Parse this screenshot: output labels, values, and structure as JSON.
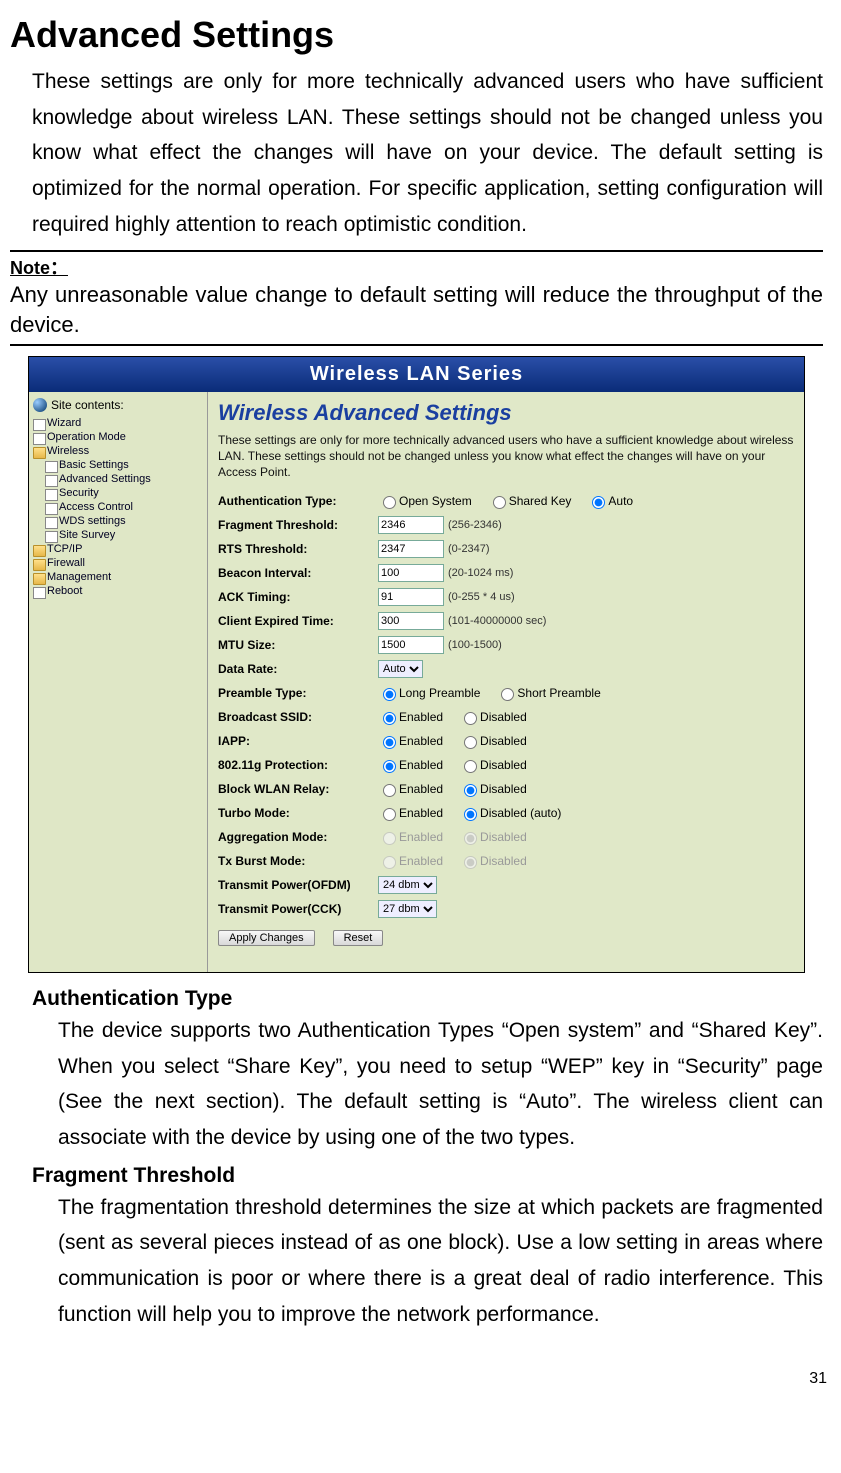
{
  "title": "Advanced Settings",
  "intro": "These settings are only for more technically advanced users who have sufficient knowledge about wireless LAN. These settings should not be changed unless you know what effect the changes will have on your device. The default setting is optimized for the normal operation. For specific application, setting configuration will required highly attention to reach optimistic condition.",
  "note_label": "Note：",
  "note_text": "Any unreasonable value change to default setting will reduce the throughput of the device.",
  "shot": {
    "banner": "Wireless LAN Series",
    "side_title": "Site contents:",
    "tree": {
      "items": [
        {
          "label": "Wizard",
          "cls": ""
        },
        {
          "label": "Operation Mode",
          "cls": ""
        },
        {
          "label": "Wireless",
          "cls": "folder",
          "children": [
            {
              "label": "Basic Settings"
            },
            {
              "label": "Advanced Settings"
            },
            {
              "label": "Security"
            },
            {
              "label": "Access Control"
            },
            {
              "label": "WDS settings"
            },
            {
              "label": "Site Survey"
            }
          ]
        },
        {
          "label": "TCP/IP",
          "cls": "folder"
        },
        {
          "label": "Firewall",
          "cls": "folder"
        },
        {
          "label": "Management",
          "cls": "folder"
        },
        {
          "label": "Reboot",
          "cls": ""
        }
      ]
    },
    "main_title": "Wireless Advanced Settings",
    "main_desc": "These settings are only for more technically advanced users who have a sufficient knowledge about wireless LAN. These settings should not be changed unless you know what effect the changes will have on your Access Point.",
    "fields": {
      "auth": {
        "label": "Authentication Type:",
        "opts": [
          "Open System",
          "Shared Key",
          "Auto"
        ],
        "sel": 2
      },
      "frag": {
        "label": "Fragment Threshold:",
        "value": "2346",
        "hint": "(256-2346)"
      },
      "rts": {
        "label": "RTS Threshold:",
        "value": "2347",
        "hint": "(0-2347)"
      },
      "beacon": {
        "label": "Beacon Interval:",
        "value": "100",
        "hint": "(20-1024 ms)"
      },
      "ack": {
        "label": "ACK Timing:",
        "value": "91",
        "hint": "(0-255 * 4 us)"
      },
      "exp": {
        "label": "Client Expired Time:",
        "value": "300",
        "hint": "(101-40000000 sec)"
      },
      "mtu": {
        "label": "MTU Size:",
        "value": "1500",
        "hint": "(100-1500)"
      },
      "rate": {
        "label": "Data Rate:",
        "value": "Auto"
      },
      "pre": {
        "label": "Preamble Type:",
        "opts": [
          "Long Preamble",
          "Short Preamble"
        ],
        "sel": 0
      },
      "bssid": {
        "label": "Broadcast SSID:",
        "opts": [
          "Enabled",
          "Disabled"
        ],
        "sel": 0
      },
      "iapp": {
        "label": "IAPP:",
        "opts": [
          "Enabled",
          "Disabled"
        ],
        "sel": 0
      },
      "gprot": {
        "label": "802.11g Protection:",
        "opts": [
          "Enabled",
          "Disabled"
        ],
        "sel": 0
      },
      "relay": {
        "label": "Block WLAN Relay:",
        "opts": [
          "Enabled",
          "Disabled"
        ],
        "sel": 1
      },
      "turbo": {
        "label": "Turbo Mode:",
        "opts": [
          "Enabled",
          "Disabled (auto)"
        ],
        "sel": 1
      },
      "agg": {
        "label": "Aggregation Mode:",
        "opts": [
          "Enabled",
          "Disabled"
        ],
        "sel": 1,
        "dis": true
      },
      "burst": {
        "label": "Tx Burst Mode:",
        "opts": [
          "Enabled",
          "Disabled"
        ],
        "sel": 1,
        "dis": true
      },
      "ofdm": {
        "label": "Transmit Power(OFDM)",
        "value": "24 dbm"
      },
      "cck": {
        "label": "Transmit Power(CCK)",
        "value": "27 dbm"
      }
    },
    "btn_apply": "Apply Changes",
    "btn_reset": "Reset"
  },
  "auth_h": "Authentication Type",
  "auth_p": "The device supports two Authentication Types “Open system” and “Shared Key”. When you select “Share Key”, you need to setup “WEP” key in “Security” page (See the next section). The default setting is “Auto”. The wireless client can associate with the device by using one of the two types.",
  "frag_h": "Fragment Threshold",
  "frag_p": "The fragmentation threshold determines the size at which packets are fragmented (sent as several pieces instead of as one block). Use a low setting in areas where communication is poor or where there is a great deal of radio interference. This function will help you to improve the network performance.",
  "pagenum": "31"
}
